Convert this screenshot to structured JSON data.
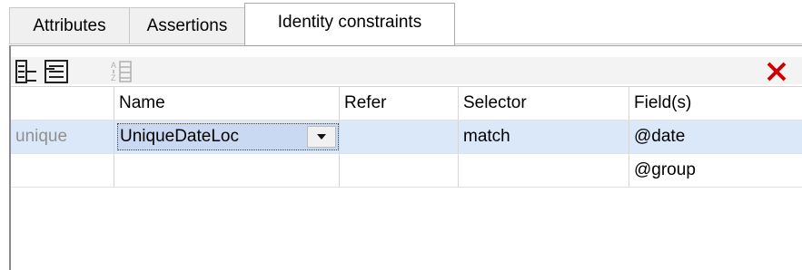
{
  "tabs": [
    {
      "label": "Attributes",
      "active": false
    },
    {
      "label": "Assertions",
      "active": false
    },
    {
      "label": "Identity constraints",
      "active": true
    }
  ],
  "toolbar": {
    "buttons": [
      "append-constraint-icon",
      "insert-constraint-icon",
      "sort-icon",
      "delete-icon"
    ],
    "delete_color": "#cc0000"
  },
  "grid": {
    "columns": [
      "",
      "Name",
      "Refer",
      "Selector",
      "Field(s)"
    ],
    "rows": [
      {
        "kind": "unique",
        "name": "UniqueDateLoc",
        "refer": "",
        "selector": "match",
        "field": "@date"
      },
      {
        "kind": "",
        "name": "",
        "refer": "",
        "selector": "",
        "field": "@group"
      }
    ]
  }
}
